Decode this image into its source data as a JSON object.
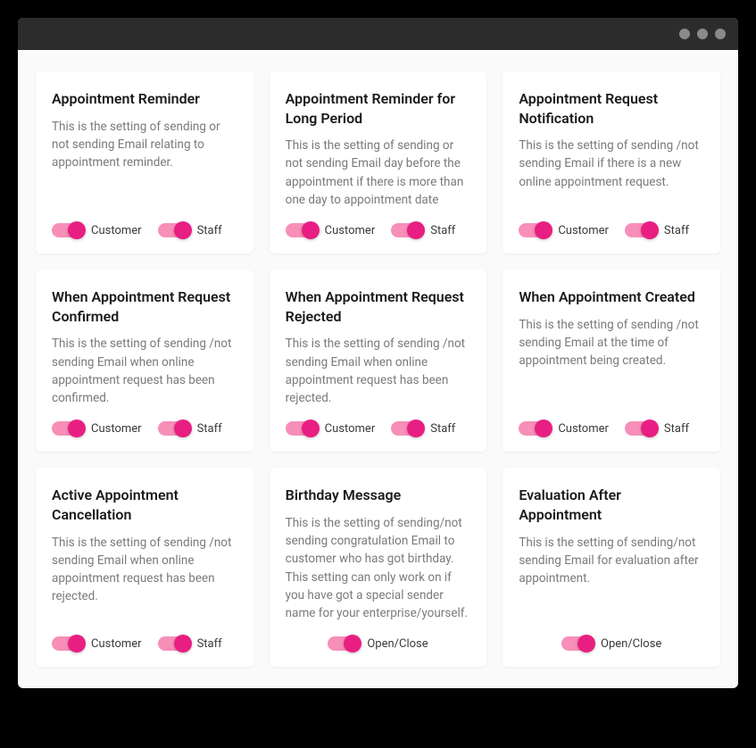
{
  "labels": {
    "customer": "Customer",
    "staff": "Staff",
    "openclose": "Open/Close"
  },
  "cards": [
    {
      "title": "Appointment Reminder",
      "desc": "This is the setting of sending or not sending Email relating to appointment reminder.",
      "toggles": "dual"
    },
    {
      "title": "Appointment Reminder for Long Period",
      "desc": "This is the setting of sending or not sending Email day before the appointment if there is more than one day to appointment date",
      "toggles": "dual"
    },
    {
      "title": "Appointment Request Notification",
      "desc": "This is the setting of sending /not sending Email if there is a new online appointment request.",
      "toggles": "dual"
    },
    {
      "title": "When Appointment Request Confirmed",
      "desc": "This is the setting of sending /not sending Email when online appointment request has been confirmed.",
      "toggles": "dual"
    },
    {
      "title": "When Appointment Request Rejected",
      "desc": "This is the setting of sending /not sending Email when online appointment request has been rejected.",
      "toggles": "dual"
    },
    {
      "title": "When Appointment Created",
      "desc": "This is the setting of sending /not sending Email at the time of appointment being created.",
      "toggles": "dual"
    },
    {
      "title": "Active Appointment Cancellation",
      "desc": "This is the setting of sending /not sending Email when online appointment request has been rejected.",
      "toggles": "dual"
    },
    {
      "title": "Birthday Message",
      "desc": "This is the setting of sending/not sending congratulation Email to customer who has got birthday. This setting can only work on if you have got a special sender name for your enterprise/yourself.",
      "toggles": "single"
    },
    {
      "title": "Evaluation After Appointment",
      "desc": "This is the setting of sending/not sending Email for evaluation after appointment.",
      "toggles": "single"
    }
  ]
}
